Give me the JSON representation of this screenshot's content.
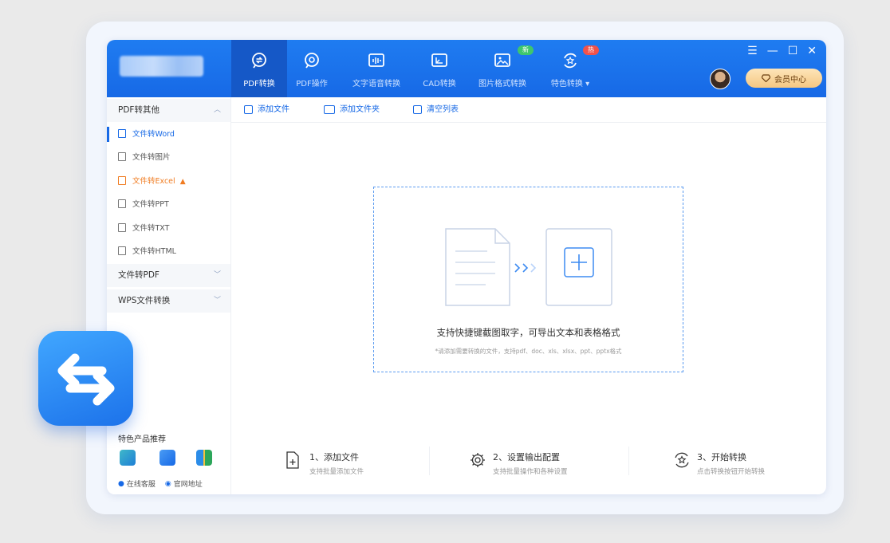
{
  "nav": {
    "tabs": [
      {
        "label": "PDF转换",
        "icon": "pdf-convert-icon",
        "active": true
      },
      {
        "label": "PDF操作",
        "icon": "pdf-operate-icon"
      },
      {
        "label": "文字语音转换",
        "icon": "audio-wave-icon"
      },
      {
        "label": "CAD转换",
        "icon": "cad-icon"
      },
      {
        "label": "图片格式转换",
        "icon": "image-icon",
        "badge": "新"
      },
      {
        "label": "特色转换 ▾",
        "icon": "star-convert-icon",
        "badge": "热"
      }
    ],
    "vip_label": "会员中心"
  },
  "colors": {
    "primary": "#1769e6",
    "hot": "#f07c22",
    "badge_new": "#3ec66d",
    "badge_hot": "#f2524a",
    "vip": "#f5c782"
  },
  "sidebar": {
    "group1": "PDF转其他",
    "items": [
      {
        "label": "文件转Word",
        "active": true
      },
      {
        "label": "文件转图片"
      },
      {
        "label": "文件转Excel",
        "hot": true
      },
      {
        "label": "文件转PPT"
      },
      {
        "label": "文件转TXT"
      },
      {
        "label": "文件转HTML"
      }
    ],
    "group2": "文件转PDF",
    "group3": "WPS文件转换",
    "products_title": "特色产品推荐",
    "support_label": "在线客服",
    "website_label": "官网地址"
  },
  "toolbar": {
    "add_file": "添加文件",
    "add_folder": "添加文件夹",
    "clear_list": "清空列表"
  },
  "dropzone": {
    "main_text": "支持快捷键截图取字，可导出文本和表格格式",
    "sub_text": "*请添加需要转换的文件，支持pdf、doc、xls、xlsx、ppt、pptx格式"
  },
  "steps": [
    {
      "title": "1、添加文件",
      "desc": "支持批量添加文件"
    },
    {
      "title": "2、设置输出配置",
      "desc": "支持批量操作和各种设置"
    },
    {
      "title": "3、开始转换",
      "desc": "点击转换按钮开始转换"
    }
  ]
}
